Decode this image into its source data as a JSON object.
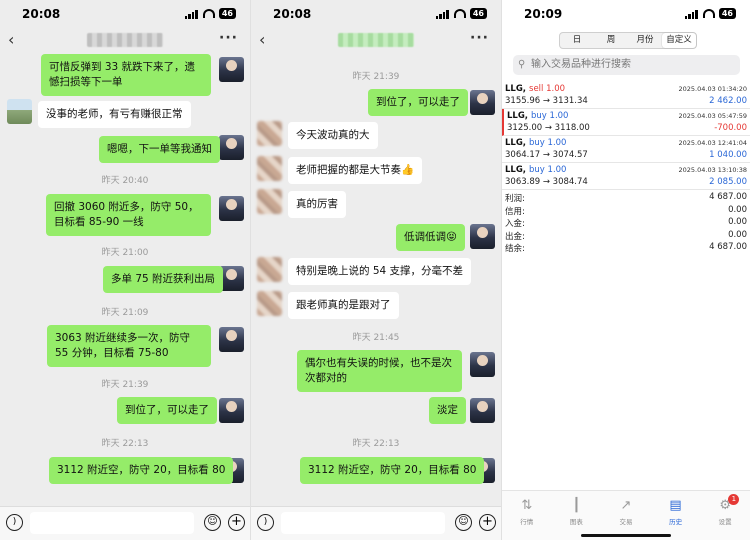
{
  "status": {
    "time1": "20:08",
    "time2": "20:08",
    "time3": "20:09",
    "battery": "46"
  },
  "chat1": {
    "messages": [
      {
        "side": "me",
        "text": "可惜反弹到 33 就跌下来了，遗憾扫损等下一单"
      },
      {
        "side": "other",
        "text": "没事的老师，有亏有赚很正常"
      },
      {
        "side": "me",
        "text": "嗯嗯，下一单等我通知"
      },
      {
        "side": "stamp",
        "text": "昨天 20:40"
      },
      {
        "side": "me",
        "text": "回撤 3060 附近多，防守 50，目标看 85-90 一线"
      },
      {
        "side": "stamp",
        "text": "昨天 21:00"
      },
      {
        "side": "me",
        "text": "多单 75 附近获利出局"
      },
      {
        "side": "stamp",
        "text": "昨天 21:09"
      },
      {
        "side": "me",
        "text": "3063 附近继续多一次，防守 55 分钟，目标看 75-80"
      },
      {
        "side": "stamp",
        "text": "昨天 21:39"
      },
      {
        "side": "me",
        "text": "到位了，可以走了"
      },
      {
        "side": "stamp",
        "text": "昨天 22:13"
      },
      {
        "side": "me",
        "text": "3112 附近空，防守 20，目标看 80"
      }
    ]
  },
  "chat2": {
    "messages": [
      {
        "side": "stamp",
        "text": "昨天 21:39"
      },
      {
        "side": "me",
        "text": "到位了，可以走了"
      },
      {
        "side": "other",
        "text": "今天波动真的大"
      },
      {
        "side": "other",
        "text": "老师把握的都是大节奏👍"
      },
      {
        "side": "other",
        "text": "真的厉害"
      },
      {
        "side": "me",
        "text": "低调低调😝"
      },
      {
        "side": "other",
        "text": "特别是晚上说的 54 支撑，分毫不差"
      },
      {
        "side": "other",
        "text": "跟老师真的是跟对了"
      },
      {
        "side": "stamp",
        "text": "昨天 21:45"
      },
      {
        "side": "me",
        "text": "偶尔也有失误的时候，也不是次次都对的"
      },
      {
        "side": "me",
        "text": "淡定"
      },
      {
        "side": "stamp",
        "text": "昨天 22:13"
      },
      {
        "side": "me",
        "text": "3112 附近空，防守 20，目标看 80"
      }
    ]
  },
  "trading": {
    "segments": [
      "日",
      "周",
      "月份",
      "自定义"
    ],
    "search_placeholder": "输入交易品种进行搜索",
    "trades": [
      {
        "symbol": "LLG,",
        "side": "sell 1.00",
        "price": "3155.96 → 3131.34",
        "datetime": "2025.04.03 01:34:20",
        "pl": "2 462.00",
        "pl_color": "#2a67d6"
      },
      {
        "symbol": "LLG,",
        "side": "buy 1.00",
        "price": "3125.00 → 3118.00",
        "datetime": "2025.04.03 05:47:59",
        "pl": "-700.00",
        "pl_color": "#e53935"
      },
      {
        "symbol": "LLG,",
        "side": "buy 1.00",
        "price": "3064.17 → 3074.57",
        "datetime": "2025.04.03 12:41:04",
        "pl": "1 040.00",
        "pl_color": "#2a67d6"
      },
      {
        "symbol": "LLG,",
        "side": "buy 1.00",
        "price": "3063.89 → 3084.74",
        "datetime": "2025.04.03 13:10:38",
        "pl": "2 085.00",
        "pl_color": "#2a67d6"
      }
    ],
    "summary": [
      {
        "k": "利润:",
        "v": "4 687.00"
      },
      {
        "k": "信用:",
        "v": "0.00"
      },
      {
        "k": "入金:",
        "v": "0.00"
      },
      {
        "k": "出金:",
        "v": "0.00"
      },
      {
        "k": "结余:",
        "v": "4 687.00"
      }
    ],
    "tabs": [
      "行情",
      "图表",
      "交易",
      "历史",
      "设置"
    ],
    "settings_badge": "1"
  }
}
